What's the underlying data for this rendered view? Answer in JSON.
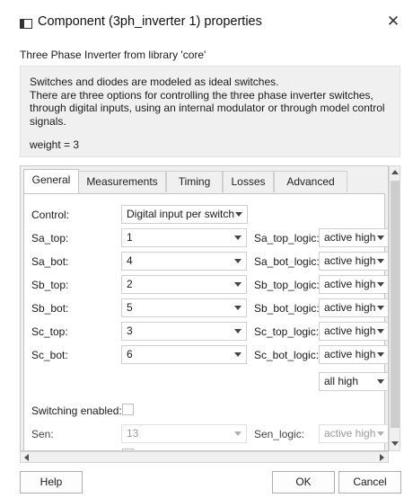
{
  "window": {
    "title": "Component (3ph_inverter 1) properties"
  },
  "subtitle": "Three Phase Inverter from library 'core'",
  "description": {
    "lines": [
      "Switches and diodes are modeled as ideal switches.",
      "There are three options for controlling the three phase inverter switches,",
      "through digital inputs, using an internal modulator or through model control",
      "signals."
    ],
    "weight": "weight = 3"
  },
  "tabs": [
    "General",
    "Measurements",
    "Timing",
    "Losses",
    "Advanced"
  ],
  "active_tab": "General",
  "general": {
    "control_label": "Control:",
    "control_value": "Digital input per switch",
    "rows": [
      {
        "label": "Sa_top:",
        "value": "1",
        "logic_label": "Sa_top_logic:",
        "logic_value": "active high"
      },
      {
        "label": "Sa_bot:",
        "value": "4",
        "logic_label": "Sa_bot_logic:",
        "logic_value": "active high"
      },
      {
        "label": "Sb_top:",
        "value": "2",
        "logic_label": "Sb_top_logic:",
        "logic_value": "active high"
      },
      {
        "label": "Sb_bot:",
        "value": "5",
        "logic_label": "Sb_bot_logic:",
        "logic_value": "active high"
      },
      {
        "label": "Sc_top:",
        "value": "3",
        "logic_label": "Sc_top_logic:",
        "logic_value": "active high"
      },
      {
        "label": "Sc_bot:",
        "value": "6",
        "logic_label": "Sc_bot_logic:",
        "logic_value": "active high"
      }
    ],
    "all_logic_value": "all high",
    "switching_enabled_label": "Switching enabled:",
    "sen_label": "Sen:",
    "sen_value": "13",
    "sen_logic_label": "Sen_logic:",
    "sen_logic_value": "active high"
  },
  "buttons": {
    "help": "Help",
    "ok": "OK",
    "cancel": "Cancel"
  }
}
